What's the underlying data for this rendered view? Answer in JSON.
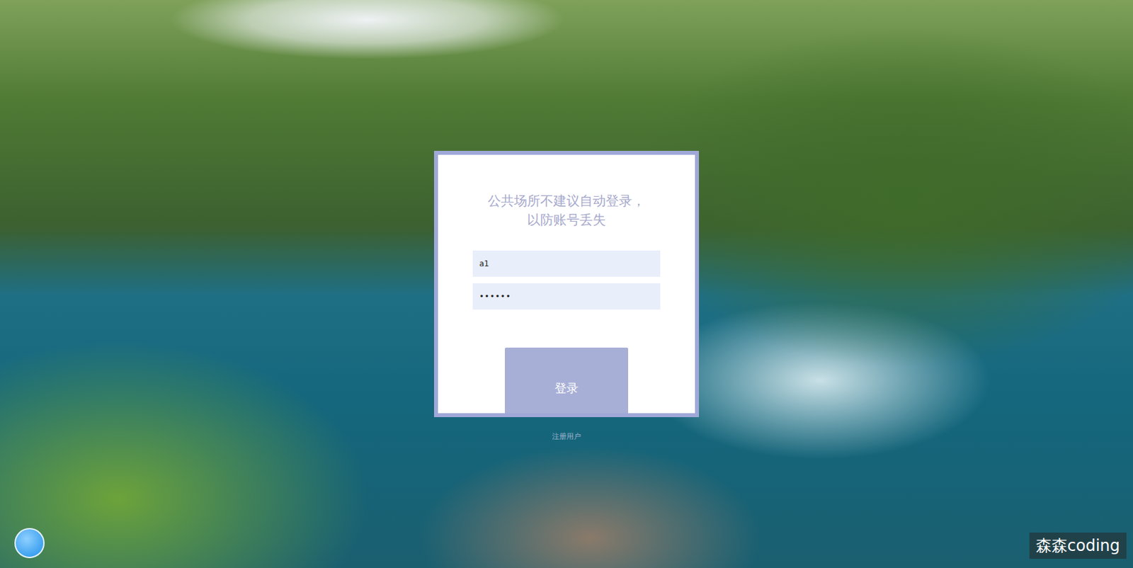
{
  "login_card": {
    "notice_lines": [
      "公共场所不建议自动登录，",
      "以防账号丢失"
    ],
    "fields": [
      {
        "kind": "text",
        "value": "a1"
      },
      {
        "kind": "password",
        "value": "••••••"
      }
    ],
    "login_button": "登录"
  },
  "register_link": "注册用户",
  "watermark": "森森coding"
}
